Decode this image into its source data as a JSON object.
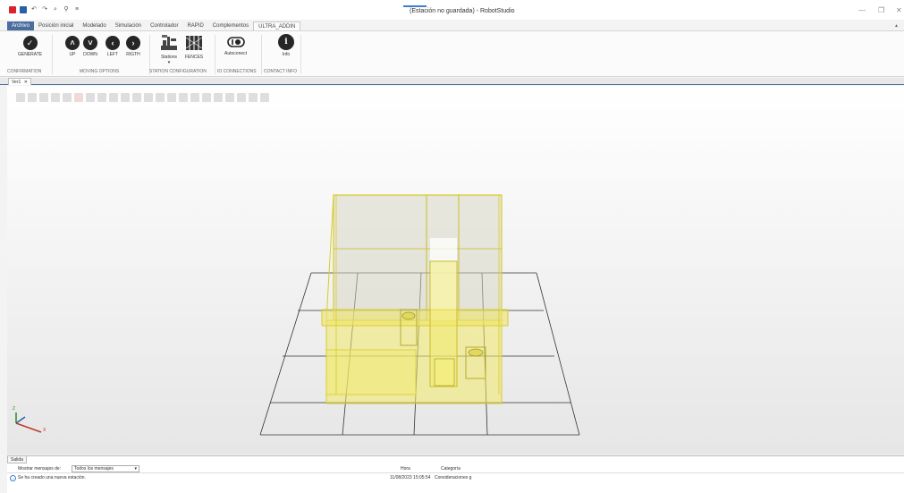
{
  "window": {
    "title": "(Estación no guardada) - RobotStudio",
    "minimize": "—",
    "restore": "❐",
    "close": "✕",
    "collapse_ribbon": "▲"
  },
  "tabs": [
    {
      "label": "Archivo"
    },
    {
      "label": "Posición inicial"
    },
    {
      "label": "Modelado"
    },
    {
      "label": "Simulación"
    },
    {
      "label": "Controlador"
    },
    {
      "label": "RAPID"
    },
    {
      "label": "Complementos"
    },
    {
      "label": "ULTRA_ADDIN"
    }
  ],
  "ribbon": {
    "confirmation": {
      "generate": "GENERATE",
      "group": "CONFIRMATION"
    },
    "moving": {
      "up": "UP",
      "down": "DOWN",
      "left": "LEFT",
      "right": "RIGTH",
      "group": "MOVING OPTIONS"
    },
    "station": {
      "stations": "Stations",
      "fences": "FENCES",
      "group": "STATION CONFIGURATION"
    },
    "io": {
      "autoconect": "Autoconect",
      "group": "IO CONNECTIONS"
    },
    "contact": {
      "info": "Info",
      "group": "CONTACT INFO"
    }
  },
  "doc_tab": {
    "label": "Ver1",
    "close": "✕"
  },
  "axes": {
    "x": "X",
    "z": "Z"
  },
  "output": {
    "tab": "Salida",
    "filter_label": "Mostrar mensajes de:",
    "filter_value": "Todos los mensajes",
    "col_time": "Hora",
    "col_category": "Categoría",
    "message": "Se ha creado una nueva estación.",
    "time": "11/08/2023 15:05:54",
    "category": "Consideraciones g"
  },
  "colors": {
    "accent": "#4a6c9e",
    "model": "#f1ea6a",
    "grid": "#333333"
  }
}
